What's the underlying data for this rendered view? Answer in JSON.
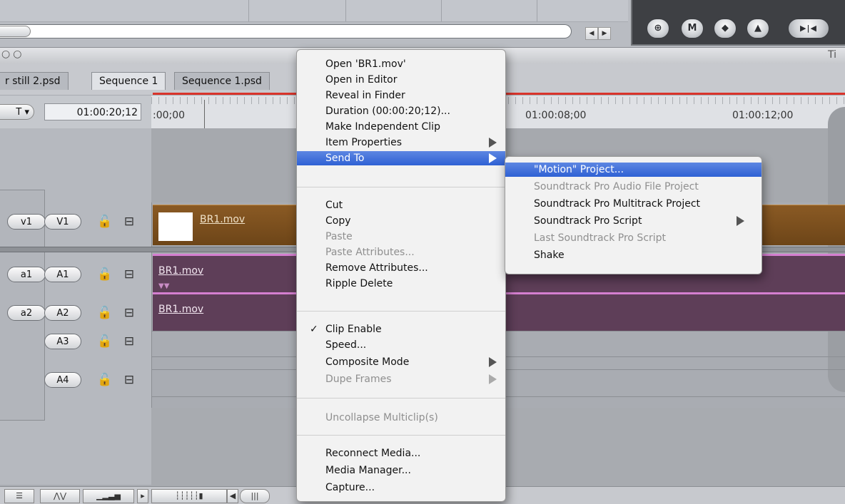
{
  "timeline": {
    "tabs": [
      "r still 2.psd",
      "Sequence 1",
      "Sequence 1.psd"
    ],
    "timecode": "01:00:20;12",
    "rt_button": "T",
    "ruler_labels": [
      ":00;00",
      "01:00:08;00",
      "01:00:12;00"
    ],
    "window_title_partial": "Ti",
    "tracks": {
      "video": [
        {
          "source": "v1",
          "dest": "V1"
        }
      ],
      "audio": [
        {
          "source": "a1",
          "dest": "A1"
        },
        {
          "source": "a2",
          "dest": "A2"
        },
        {
          "source": "",
          "dest": "A3"
        },
        {
          "source": "",
          "dest": "A4"
        }
      ]
    },
    "clips": {
      "video_clip": "BR1.mov",
      "audio1_clip": "BR1.mov",
      "audio2_clip": "BR1.mov"
    }
  },
  "context_menu": {
    "groups": [
      [
        {
          "label": "Open 'BR1.mov'",
          "enabled": true
        },
        {
          "label": "Open in Editor",
          "enabled": true
        },
        {
          "label": "Reveal in Finder",
          "enabled": true
        },
        {
          "label": "Duration (00:00:20;12)...",
          "enabled": true
        },
        {
          "label": "Make Independent Clip",
          "enabled": true
        },
        {
          "label": "Item Properties",
          "enabled": true,
          "submenu": true
        },
        {
          "label": "Send To",
          "enabled": true,
          "submenu": true,
          "selected": true
        }
      ],
      [
        {
          "label": "Cut",
          "enabled": true
        },
        {
          "label": "Copy",
          "enabled": true
        },
        {
          "label": "Paste",
          "enabled": false
        },
        {
          "label": "Paste Attributes...",
          "enabled": false
        },
        {
          "label": "Remove Attributes...",
          "enabled": true
        },
        {
          "label": "Ripple Delete",
          "enabled": true
        }
      ],
      [
        {
          "label": "Clip Enable",
          "enabled": true,
          "checked": true
        },
        {
          "label": "Speed...",
          "enabled": true
        },
        {
          "label": "Composite Mode",
          "enabled": true,
          "submenu": true
        },
        {
          "label": "Dupe Frames",
          "enabled": false,
          "submenu": true
        }
      ],
      [
        {
          "label": "Uncollapse Multiclip(s)",
          "enabled": false
        }
      ],
      [
        {
          "label": "Reconnect Media...",
          "enabled": true
        },
        {
          "label": "Media Manager...",
          "enabled": true
        },
        {
          "label": "Capture...",
          "enabled": true
        }
      ]
    ]
  },
  "send_to_submenu": [
    {
      "label": "\"Motion\" Project...",
      "enabled": true,
      "selected": true
    },
    {
      "label": "Soundtrack Pro Audio File Project",
      "enabled": false
    },
    {
      "label": "Soundtrack Pro Multitrack Project",
      "enabled": true
    },
    {
      "label": "Soundtrack Pro Script",
      "enabled": true,
      "submenu": true
    },
    {
      "label": "Last Soundtrack Pro Script",
      "enabled": false
    },
    {
      "label": "Shake",
      "enabled": true
    }
  ]
}
